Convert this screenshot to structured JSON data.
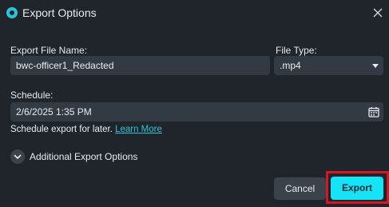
{
  "window": {
    "title": "Export Options",
    "app_icon": "app-logo-icon",
    "close_icon": "close-icon"
  },
  "form": {
    "file_name_label": "Export File Name:",
    "file_name_value": "bwc-officer1_Redacted",
    "file_type_label": "File Type:",
    "file_type_value": ".mp4",
    "schedule_label": "Schedule:",
    "schedule_value": "2/6/2025 1:35 PM",
    "schedule_helper": "Schedule export for later.",
    "learn_more": "Learn More",
    "additional_options": "Additional Export Options"
  },
  "actions": {
    "cancel": "Cancel",
    "export": "Export"
  },
  "colors": {
    "background": "#1f252b",
    "field": "#323b44",
    "accent": "#16e3f5",
    "link": "#2bc4d8",
    "highlight": "#d6171f"
  }
}
